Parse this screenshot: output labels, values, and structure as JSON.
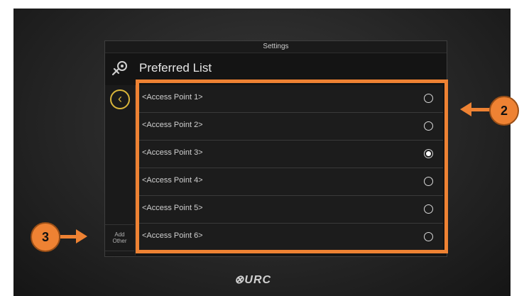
{
  "screen": {
    "window_title": "Settings",
    "header_title": "Preferred List",
    "add_other_line1": "Add",
    "add_other_line2": "Other",
    "back_icon": "chevron-left-icon",
    "settings_icon": "wrench-gear-icon"
  },
  "access_points": [
    {
      "label": "<Access Point 1>",
      "selected": false
    },
    {
      "label": "<Access Point 2>",
      "selected": false
    },
    {
      "label": "<Access Point 3>",
      "selected": true
    },
    {
      "label": "<Access Point 4>",
      "selected": false
    },
    {
      "label": "<Access Point 5>",
      "selected": false
    },
    {
      "label": "<Access Point 6>",
      "selected": false
    }
  ],
  "callouts": {
    "list_callout": "2",
    "add_other_callout": "3",
    "accent_color": "#ee8233"
  },
  "brand": {
    "logo_text": "⊗URC"
  }
}
